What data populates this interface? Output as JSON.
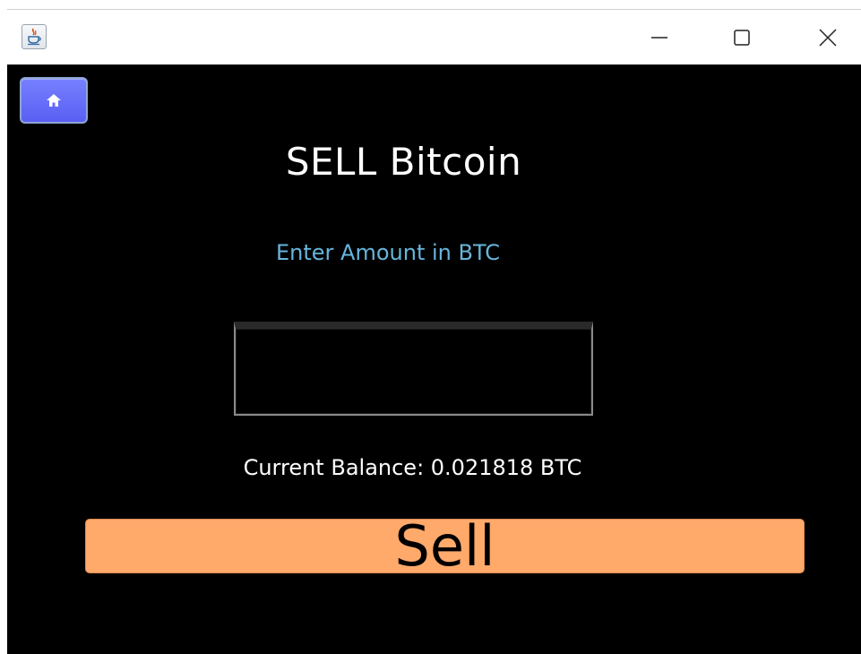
{
  "window": {
    "controls": {
      "minimize_icon": "minimize-icon",
      "maximize_icon": "maximize-icon",
      "close_icon": "close-icon"
    }
  },
  "toolbar": {
    "home_icon": "home-icon",
    "home_color": "#5a5ff2"
  },
  "main": {
    "title": "SELL Bitcoin",
    "amount_label": "Enter Amount in BTC",
    "amount_value": "",
    "balance_text": "Current Balance: 0.021818 BTC",
    "sell_label": "Sell",
    "sell_color": "#ffa96b",
    "label_color": "#67b5dc"
  }
}
